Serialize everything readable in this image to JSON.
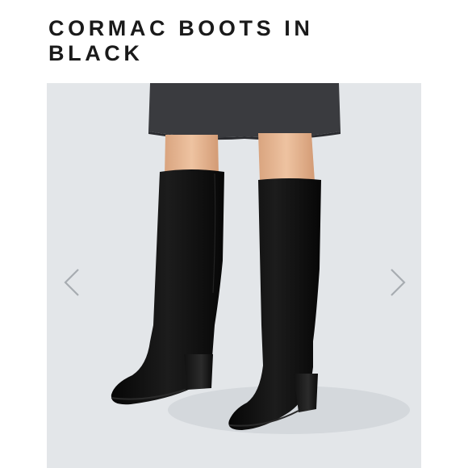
{
  "product": {
    "title_line1": "CORMAC BOOTS IN",
    "title_line2": "BLACK"
  },
  "gallery": {
    "image_subject": "woman wearing black suede knee-high block-heel boots with grey skirt",
    "prev_icon": "chevron-left-icon",
    "next_icon": "chevron-right-icon"
  },
  "colors": {
    "background": "#ffffff",
    "image_backdrop": "#e3e6e9",
    "title_text": "#1a1a1a",
    "arrow": "#a7acb1",
    "boot": "#0d0d0d",
    "skirt": "#3a3b3f",
    "skin": "#e4b38f"
  }
}
